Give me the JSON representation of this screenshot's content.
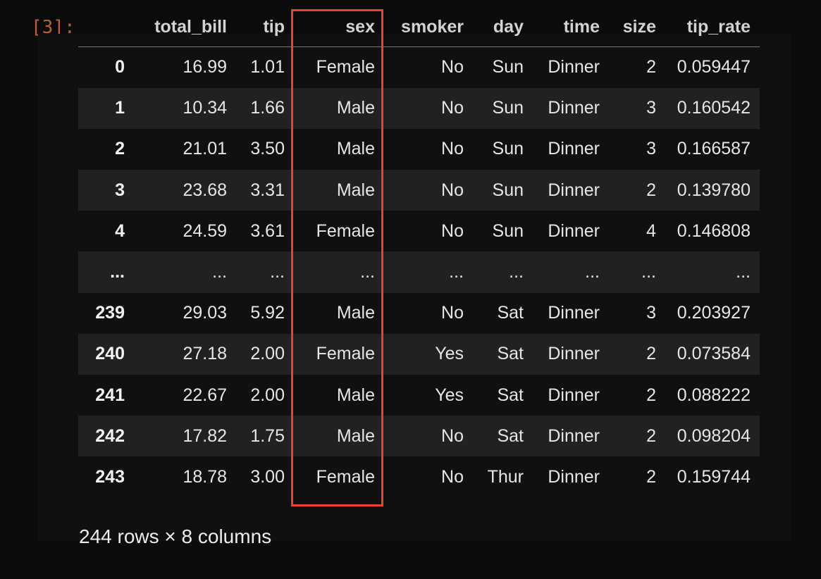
{
  "cell": {
    "prompt": "[3]:"
  },
  "dataframe": {
    "columns": [
      "total_bill",
      "tip",
      "sex",
      "smoker",
      "day",
      "time",
      "size",
      "tip_rate"
    ],
    "rows": [
      {
        "index": "0",
        "cells": [
          "16.99",
          "1.01",
          "Female",
          "No",
          "Sun",
          "Dinner",
          "2",
          "0.059447"
        ]
      },
      {
        "index": "1",
        "cells": [
          "10.34",
          "1.66",
          "Male",
          "No",
          "Sun",
          "Dinner",
          "3",
          "0.160542"
        ]
      },
      {
        "index": "2",
        "cells": [
          "21.01",
          "3.50",
          "Male",
          "No",
          "Sun",
          "Dinner",
          "3",
          "0.166587"
        ]
      },
      {
        "index": "3",
        "cells": [
          "23.68",
          "3.31",
          "Male",
          "No",
          "Sun",
          "Dinner",
          "2",
          "0.139780"
        ]
      },
      {
        "index": "4",
        "cells": [
          "24.59",
          "3.61",
          "Female",
          "No",
          "Sun",
          "Dinner",
          "4",
          "0.146808"
        ]
      },
      {
        "index": "...",
        "cells": [
          "...",
          "...",
          "...",
          "...",
          "...",
          "...",
          "...",
          "..."
        ]
      },
      {
        "index": "239",
        "cells": [
          "29.03",
          "5.92",
          "Male",
          "No",
          "Sat",
          "Dinner",
          "3",
          "0.203927"
        ]
      },
      {
        "index": "240",
        "cells": [
          "27.18",
          "2.00",
          "Female",
          "Yes",
          "Sat",
          "Dinner",
          "2",
          "0.073584"
        ]
      },
      {
        "index": "241",
        "cells": [
          "22.67",
          "2.00",
          "Male",
          "Yes",
          "Sat",
          "Dinner",
          "2",
          "0.088222"
        ]
      },
      {
        "index": "242",
        "cells": [
          "17.82",
          "1.75",
          "Male",
          "No",
          "Sat",
          "Dinner",
          "2",
          "0.098204"
        ]
      },
      {
        "index": "243",
        "cells": [
          "18.78",
          "3.00",
          "Female",
          "No",
          "Thur",
          "Dinner",
          "2",
          "0.159744"
        ]
      }
    ],
    "shape_caption": "244 rows × 8 columns"
  },
  "highlight": {
    "column": "sex",
    "color": "#e8432e"
  }
}
